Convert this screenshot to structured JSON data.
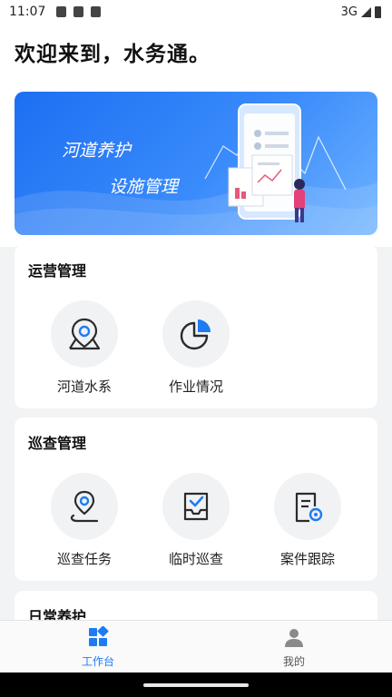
{
  "status_bar": {
    "time": "11:07",
    "network": "3G"
  },
  "header": {
    "title": "欢迎来到，水务通。"
  },
  "banner": {
    "line1": "河道养护",
    "line2": "设施管理"
  },
  "sections": {
    "operations": {
      "title": "运营管理",
      "items": [
        {
          "label": "河道水系",
          "icon": "map-pin-icon"
        },
        {
          "label": "作业情况",
          "icon": "pie-chart-icon"
        }
      ]
    },
    "inspection": {
      "title": "巡查管理",
      "items": [
        {
          "label": "巡查任务",
          "icon": "route-pin-icon"
        },
        {
          "label": "临时巡查",
          "icon": "tray-check-icon"
        },
        {
          "label": "案件跟踪",
          "icon": "document-track-icon"
        }
      ]
    },
    "daily": {
      "title": "日常养护"
    }
  },
  "tabbar": {
    "items": [
      {
        "label": "工作台",
        "active": true
      },
      {
        "label": "我的",
        "active": false
      }
    ]
  },
  "colors": {
    "accent": "#1e7cf2",
    "icon_stroke": "#2b2b2b",
    "inactive_tab": "#8a8a8a"
  }
}
